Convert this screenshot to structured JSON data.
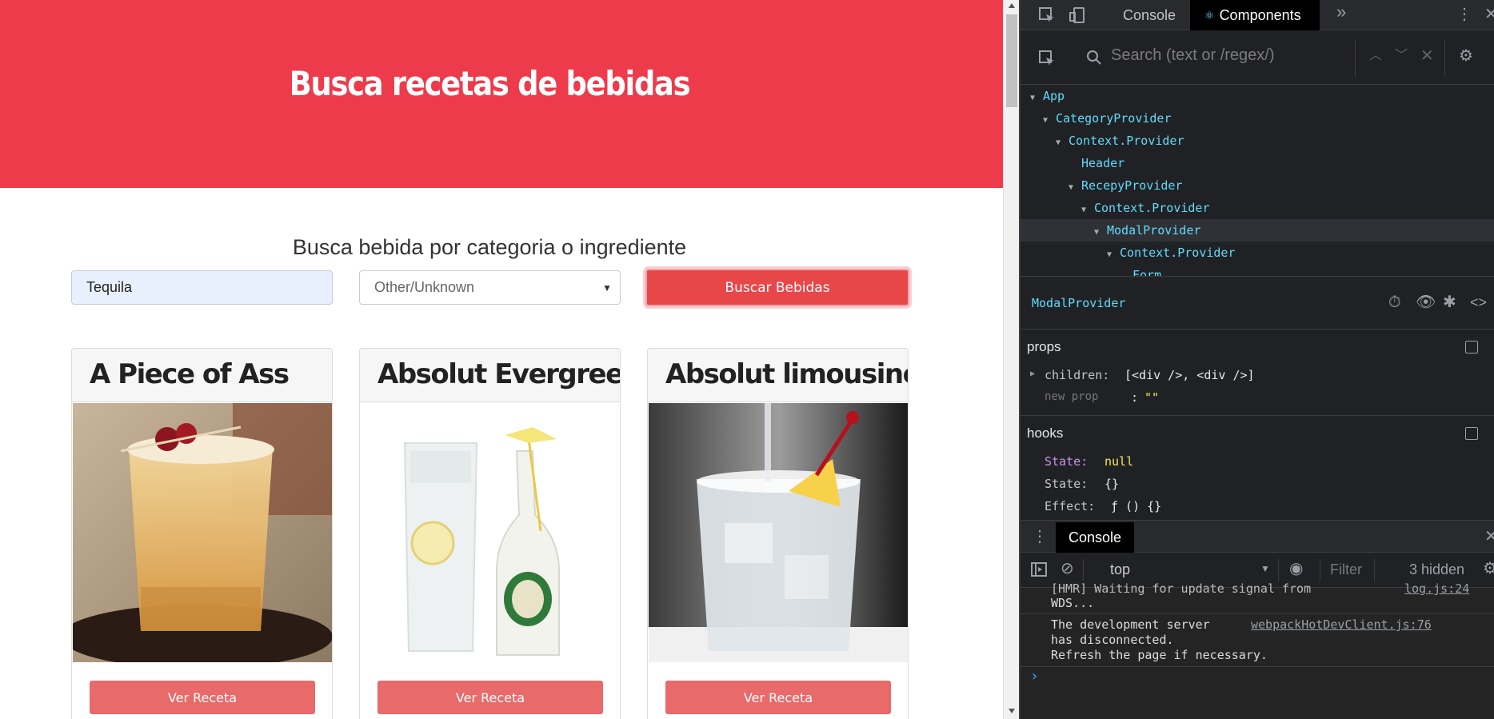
{
  "page": {
    "hero_title": "Busca recetas de bebidas",
    "search_heading": "Busca bebida por categoria o ingrediente",
    "ingredient_value": "Tequila",
    "category_value": "Other/Unknown",
    "search_button": "Buscar Bebidas",
    "cards": [
      {
        "title": "A Piece of Ass",
        "button": "Ver Receta"
      },
      {
        "title": "Absolut Evergreen",
        "button": "Ver Receta"
      },
      {
        "title": "Absolut limousine",
        "button": "Ver Receta"
      }
    ]
  },
  "devtools": {
    "tabs": [
      "Console",
      "Components"
    ],
    "more_tabs_glyph": "»",
    "search_placeholder": "Search (text or /regex/)",
    "tree": [
      {
        "label": "App",
        "expanded": true
      },
      {
        "label": "CategoryProvider",
        "expanded": true
      },
      {
        "label": "Context.Provider",
        "expanded": true
      },
      {
        "label": "Header",
        "expanded": false
      },
      {
        "label": "RecepyProvider",
        "expanded": true
      },
      {
        "label": "Context.Provider",
        "expanded": true
      },
      {
        "label": "ModalProvider",
        "expanded": true,
        "selected": true
      },
      {
        "label": "Context.Provider",
        "expanded": true
      },
      {
        "label": "Form",
        "expanded": false
      }
    ],
    "selected_component": "ModalProvider",
    "props_title": "props",
    "props": {
      "children_key": "children:",
      "children_value": "[<div />, <div />]",
      "new_prop_key": "new prop",
      "new_prop_sep": ":",
      "new_prop_value": "\"\""
    },
    "hooks_title": "hooks",
    "hooks": [
      {
        "key": "State:",
        "value": "null"
      },
      {
        "key": "State:",
        "value": "{}"
      },
      {
        "key": "Effect:",
        "value": "ƒ () {}"
      }
    ],
    "console_tab": "Console",
    "context_value": "top",
    "filter_placeholder": "Filter",
    "hidden_count": "3 hidden",
    "log": {
      "partial_line": "[HMR] Waiting for update signal from",
      "partial_link": "log.js:24",
      "wds": "WDS...",
      "line1": "The development server",
      "link": "webpackHotDevClient.js:76",
      "line2": "has disconnected.",
      "line3": "Refresh the page if necessary.",
      "prompt": "›"
    }
  },
  "colors": {
    "hero": "#ed3b4b",
    "button": "#e8474a",
    "card_button": "#e96a6a",
    "react_blue": "#61dafb"
  }
}
